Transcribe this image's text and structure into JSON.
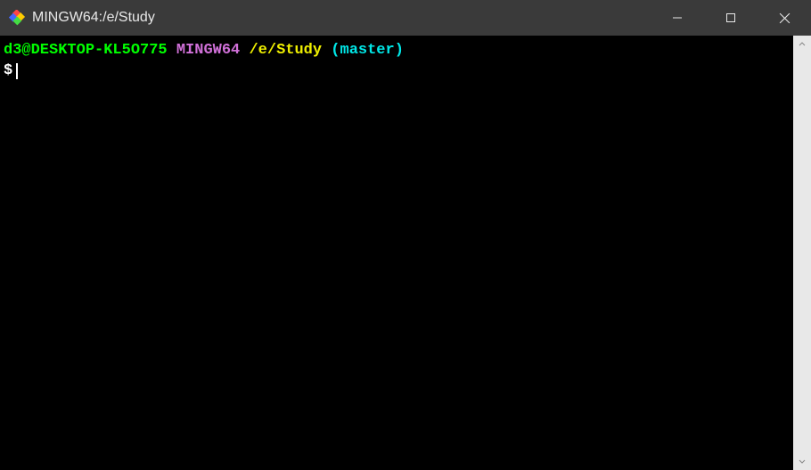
{
  "window": {
    "title": "MINGW64:/e/Study"
  },
  "terminal": {
    "user_host": "d3@DESKTOP-KL5O775",
    "env": "MINGW64",
    "path": "/e/Study",
    "branch": "(master)",
    "prompt_symbol": "$"
  }
}
